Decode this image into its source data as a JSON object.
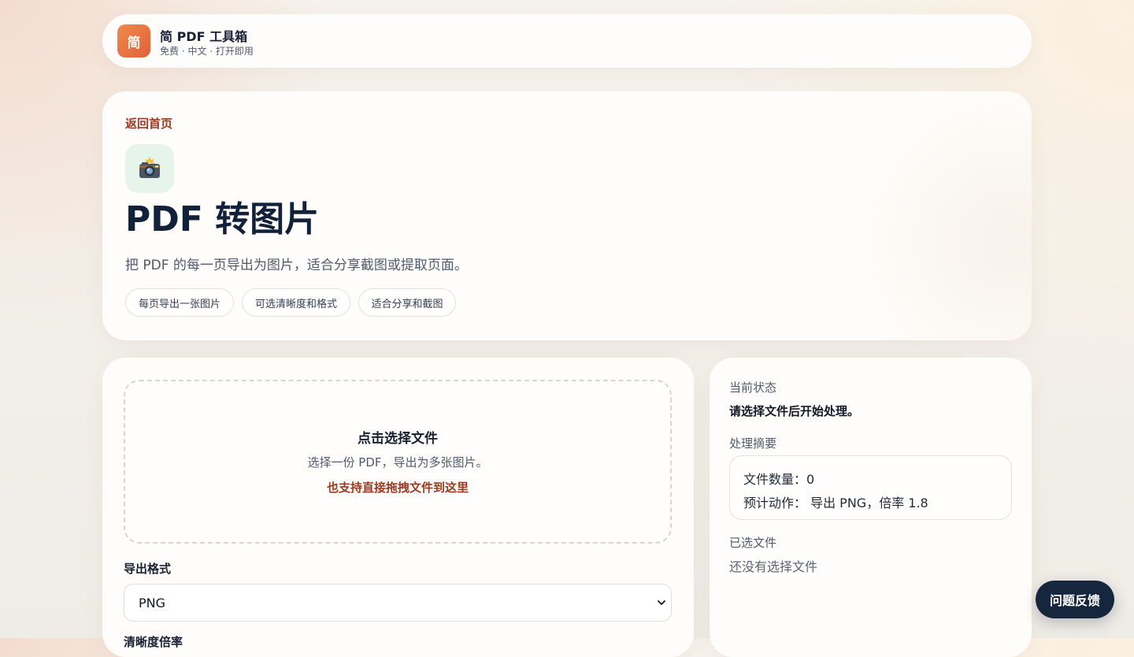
{
  "header": {
    "brand_badge": "简",
    "title": "简 PDF 工具箱",
    "subtitle": "免费 · 中文 · 打开即用"
  },
  "hero": {
    "back_link": "返回首页",
    "icon": "camera-flash-icon",
    "title": "PDF 转图片",
    "description": "把 PDF 的每一页导出为图片，适合分享截图或提取页面。",
    "tags": [
      "每页导出一张图片",
      "可选清晰度和格式",
      "适合分享和截图"
    ]
  },
  "upload": {
    "title": "点击选择文件",
    "description": "选择一份 PDF，导出为多张图片。",
    "hint": "也支持直接拖拽文件到这里"
  },
  "options": {
    "format_label": "导出格式",
    "format_value": "PNG",
    "clarity_label": "清晰度倍率"
  },
  "status": {
    "status_label": "当前状态",
    "status_text": "请选择文件后开始处理。",
    "summary_label": "处理摘要",
    "file_count_line": "文件数量：0",
    "action_line": "预计动作：  导出 PNG，倍率 1.8",
    "selected_label": "已选文件",
    "selected_empty": "还没有选择文件"
  },
  "feedback": {
    "label": "问题反馈"
  },
  "colors": {
    "accent": "#9b3a1f",
    "brand_gradient_start": "#f08a4b",
    "brand_gradient_end": "#e0603a",
    "dark_button": "#16263d",
    "icon_bg": "#e7f4ec"
  }
}
